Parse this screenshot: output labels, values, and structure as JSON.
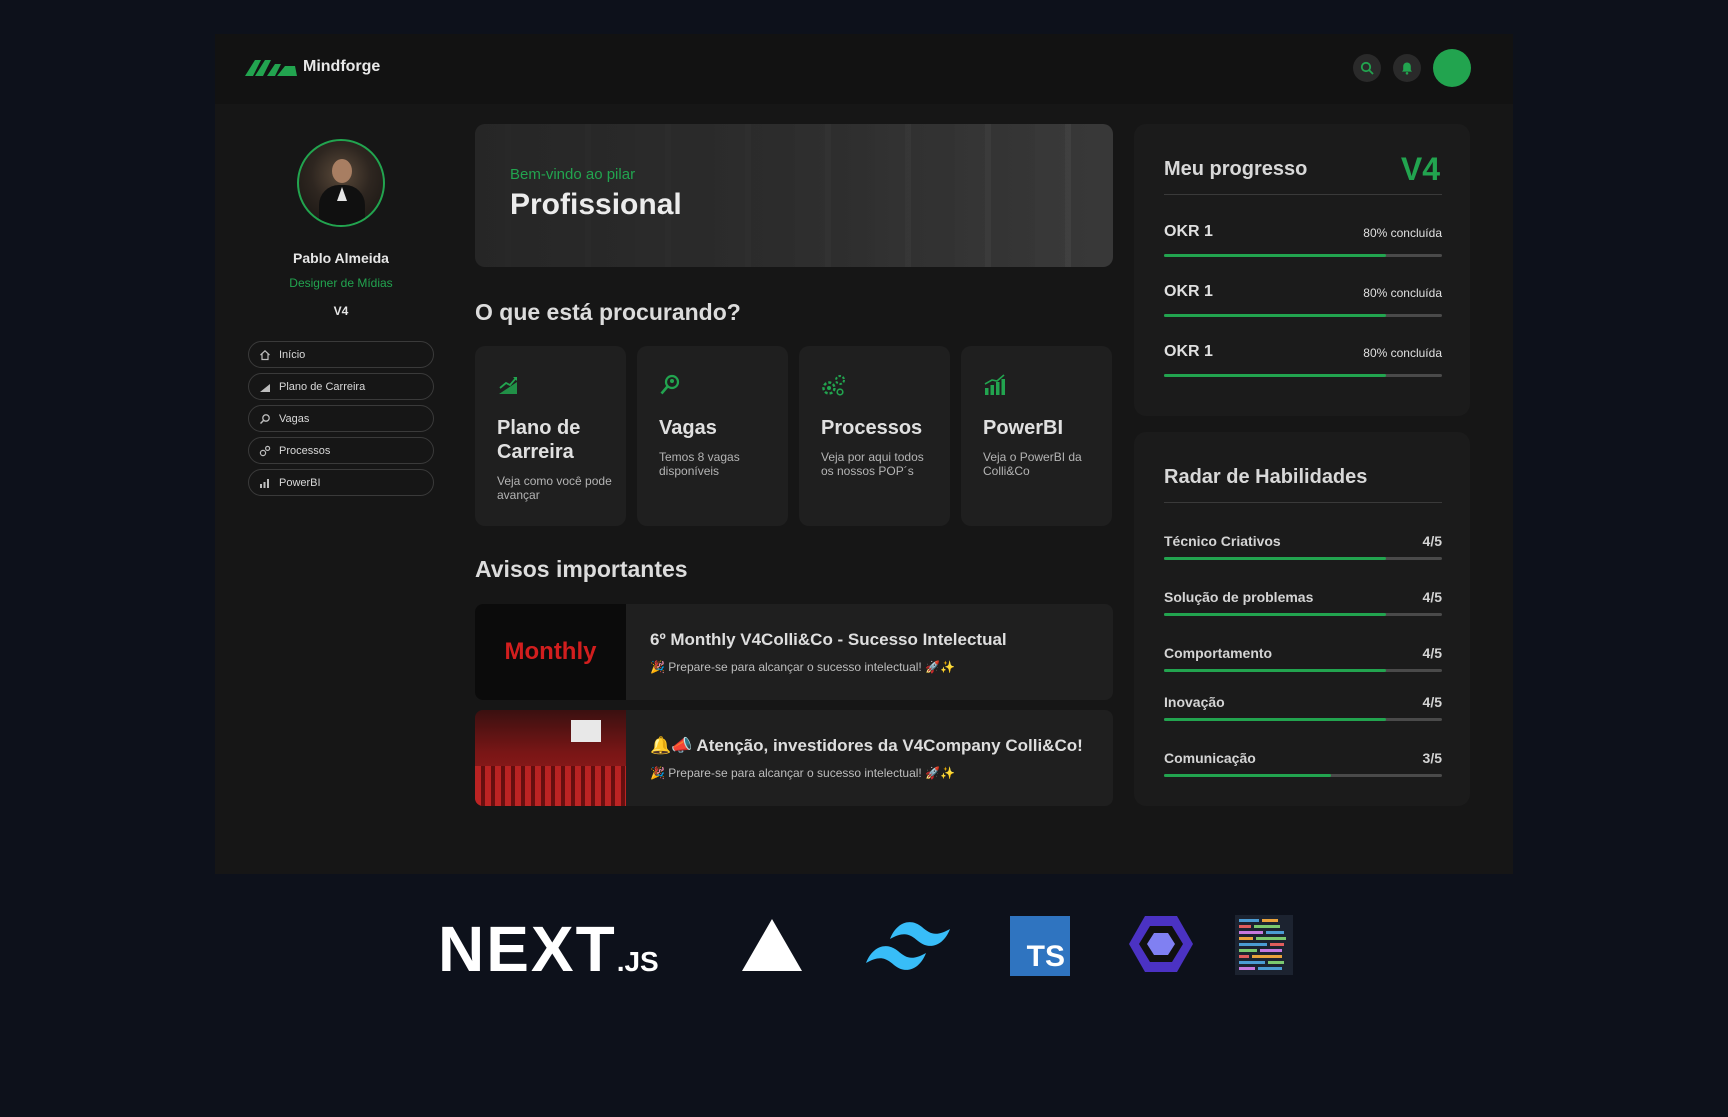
{
  "brand": {
    "name": "Mindforge",
    "accent": "#22a44f"
  },
  "header": {
    "icons": [
      "search-icon",
      "bell-icon"
    ]
  },
  "profile": {
    "name": "Pablo Almeida",
    "role": "Designer de Mídias",
    "level": "V4"
  },
  "sidebar": {
    "items": [
      {
        "label": "Início",
        "icon": "home-icon"
      },
      {
        "label": "Plano de Carreira",
        "icon": "chart-icon"
      },
      {
        "label": "Vagas",
        "icon": "search-icon"
      },
      {
        "label": "Processos",
        "icon": "gears-icon"
      },
      {
        "label": "PowerBI",
        "icon": "bar-chart-icon"
      }
    ]
  },
  "hero": {
    "subtitle": "Bem-vindo ao pilar",
    "title": "Profissional"
  },
  "search_section": {
    "title": "O que está procurando?"
  },
  "cards": [
    {
      "title": "Plano de Carreira",
      "desc": "Veja como você pode avançar",
      "icon": "growth-chart-icon"
    },
    {
      "title": "Vagas",
      "desc": "Temos 8 vagas disponíveis",
      "icon": "magnifier-icon"
    },
    {
      "title": "Processos",
      "desc": "Veja por aqui todos os nossos POP´s",
      "icon": "gears-icon"
    },
    {
      "title": "PowerBI",
      "desc": "Veja o PowerBI da Colli&Co",
      "icon": "bar-chart-icon"
    }
  ],
  "notices_section": {
    "title": "Avisos importantes"
  },
  "notices": [
    {
      "thumb_text": "Monthly",
      "title": "6º Monthly V4Colli&Co - Sucesso Intelectual",
      "desc": "🎉 Prepare-se para alcançar o sucesso intelectual! 🚀✨"
    },
    {
      "title": "🔔📣 Atenção, investidores da V4Company Colli&Co!",
      "desc": "🎉 Prepare-se para alcançar o sucesso intelectual! 🚀✨"
    }
  ],
  "progress": {
    "title": "Meu progresso",
    "level": "V4",
    "items": [
      {
        "label": "OKR 1",
        "status": "80% concluída",
        "value": 0.8
      },
      {
        "label": "OKR 1",
        "status": "80% concluída",
        "value": 0.8
      },
      {
        "label": "OKR 1",
        "status": "80% concluída",
        "value": 0.8
      }
    ]
  },
  "skills": {
    "title": "Radar de Habilidades",
    "items": [
      {
        "label": "Técnico Criativos",
        "score": "4/5",
        "value": 0.8
      },
      {
        "label": "Solução de problemas",
        "score": "4/5",
        "value": 0.8
      },
      {
        "label": "Comportamento",
        "score": "4/5",
        "value": 0.8
      },
      {
        "label": "Inovação",
        "score": "4/5",
        "value": 0.8
      },
      {
        "label": "Comunicação",
        "score": "3/5",
        "value": 0.6
      }
    ]
  },
  "tech_stack": {
    "next": "NEXT",
    "next_suffix": ".JS",
    "ts": "TS",
    "logos": [
      "nextjs-logo",
      "vercel-logo",
      "tailwind-logo",
      "typescript-logo",
      "eslint-logo",
      "code-file-icon"
    ]
  }
}
